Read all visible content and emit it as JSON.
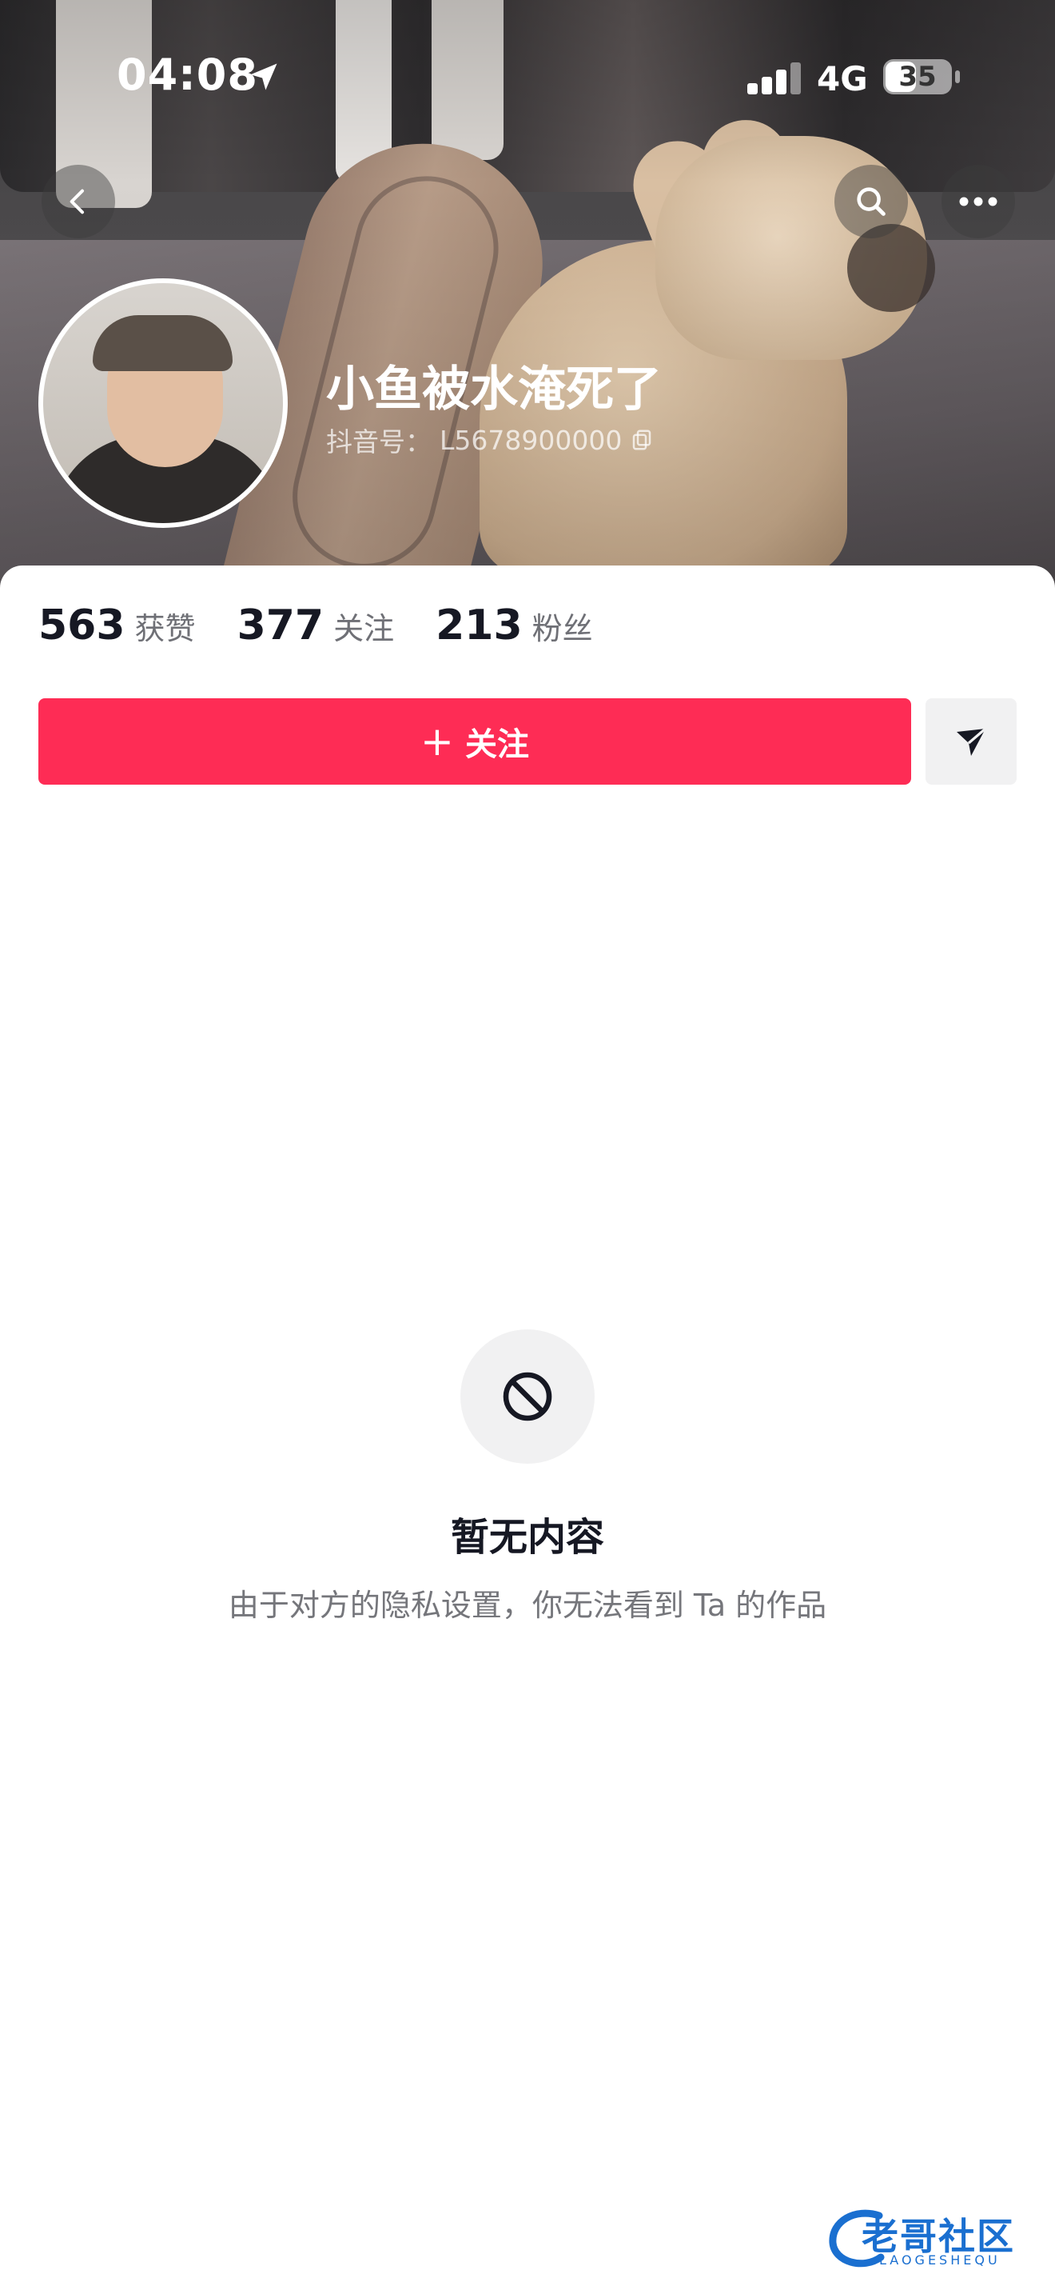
{
  "status_bar": {
    "time": "04:08",
    "network": "4G",
    "battery": "35"
  },
  "nav": {
    "back_icon": "chevron-left-icon",
    "search_icon": "search-icon",
    "more_icon": "more-icon"
  },
  "profile": {
    "name": "小鱼被水淹死了",
    "id_label": "抖音号：",
    "id_value": "L5678900000",
    "copy_icon": "copy-icon"
  },
  "stats": [
    {
      "value": "563",
      "label": "获赞"
    },
    {
      "value": "377",
      "label": "关注"
    },
    {
      "value": "213",
      "label": "粉丝"
    }
  ],
  "actions": {
    "follow_plus": "+",
    "follow_label": "关注",
    "send_icon": "send-icon"
  },
  "empty_state": {
    "icon": "block-icon",
    "title": "暂无内容",
    "description": "由于对方的隐私设置，你无法看到 Ta 的作品"
  },
  "watermark": {
    "text": "老哥社区",
    "sub": "LAOGESHEQU"
  },
  "colors": {
    "accent": "#fe2c55",
    "text_primary": "#161823",
    "text_secondary": "#75767b",
    "button_gray": "#f1f1f2"
  }
}
